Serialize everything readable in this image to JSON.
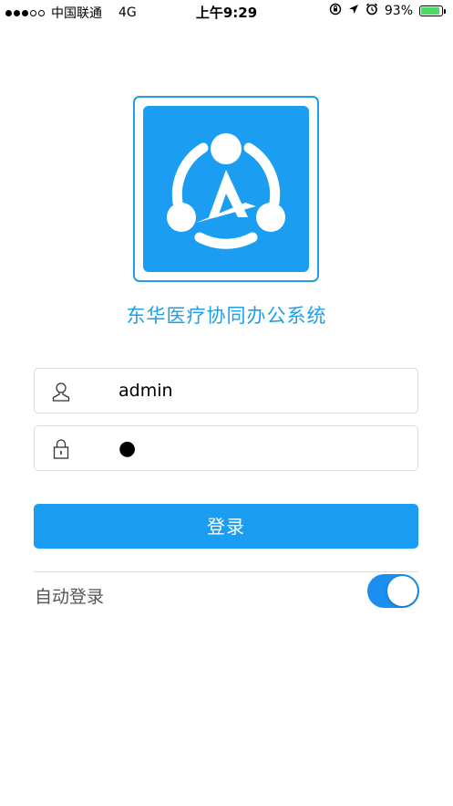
{
  "status_bar": {
    "carrier": "中国联通",
    "network": "4G",
    "time": "上午9:29",
    "battery_percent": "93%",
    "battery_level": 0.93,
    "icons": [
      "orientation-lock-icon",
      "location-arrow-icon",
      "alarm-icon",
      "battery-icon"
    ]
  },
  "app": {
    "title": "东华医疗协同办公系统",
    "logo_icon": "network-a-logo-icon",
    "brand_color": "#1b9ef2"
  },
  "form": {
    "username": {
      "value": "admin",
      "icon": "user-icon"
    },
    "password": {
      "value": "●",
      "icon": "lock-icon"
    },
    "login_label": "登录",
    "auto_login_label": "自动登录",
    "auto_login_on": true
  }
}
